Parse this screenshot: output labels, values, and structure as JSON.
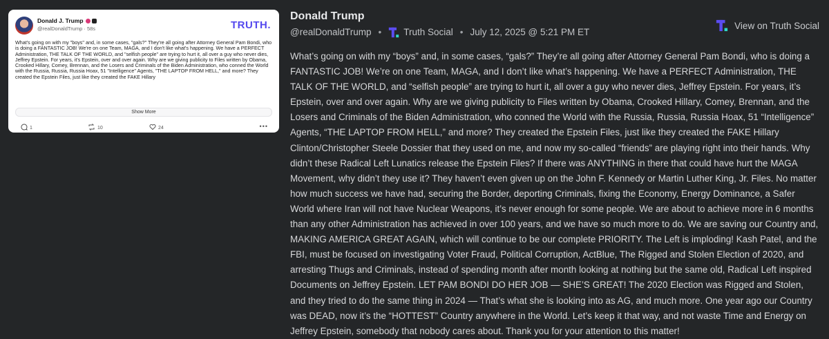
{
  "screenshot": {
    "display_name": "Donald J. Trump",
    "handle_time": "@realDonaldTrump · 58s",
    "logo_text": "TRUTH.",
    "preview_text": "What's going on with my \"boys\" and, in some cases, \"gals?\" They're all going after Attorney General Pam Bondi, who is doing a FANTASTIC JOB! We're on one Team, MAGA, and I don't like what's happening. We have a PERFECT Administration, THE TALK OF THE WORLD, and \"selfish people\" are trying to hurt it, all over a guy who never dies, Jeffrey Epstein. For years, it's Epstein, over and over again. Why are we giving publicity to Files written by Obama, Crooked Hillary, Comey, Brennan, and the Losers and Criminals of the Biden Administration, who conned the World with the Russia, Russia, Russia Hoax, 51 \"Intelligence\" Agents, \"THE LAPTOP FROM HELL,\" and more? They created the Epstein Files, just like they created the FAKE Hillary",
    "show_more": "Show More",
    "replies": "1",
    "retruths": "10",
    "likes": "24"
  },
  "post": {
    "author": "Donald Trump",
    "handle": "@realDonaldTrump",
    "platform": "Truth Social",
    "date": "July 12, 2025 @ 5:21 PM ET",
    "view_link": "View on Truth Social",
    "brand_color": "#5b4cf0",
    "body": "What’s going on with my “boys” and, in some cases, “gals?” They’re all going after Attorney General Pam Bondi, who is doing a FANTASTIC JOB! We’re on one Team, MAGA, and I don’t like what’s happening. We have a PERFECT Administration, THE TALK OF THE WORLD, and “selfish people” are trying to hurt it, all over a guy who never dies, Jeffrey Epstein. For years, it’s Epstein, over and over again. Why are we giving publicity to Files written by Obama, Crooked Hillary, Comey, Brennan, and the Losers and Criminals of the Biden Administration, who conned the World with the Russia, Russia, Russia Hoax, 51 “Intelligence” Agents, “THE LAPTOP FROM HELL,” and more? They created the Epstein Files, just like they created the FAKE Hillary Clinton/Christopher Steele Dossier that they used on me, and now my so-called “friends” are playing right into their hands. Why didn’t these Radical Left Lunatics release the Epstein Files? If there was ANYTHING in there that could have hurt the MAGA Movement, why didn’t they use it? They haven’t even given up on the John F. Kennedy or Martin Luther King, Jr. Files. No matter how much success we have had, securing the Border, deporting Criminals, fixing the Economy, Energy Dominance, a Safer World where Iran will not have Nuclear Weapons, it’s never enough for some people. We are about to achieve more in 6 months than any other Administration has achieved in over 100 years, and we have so much more to do. We are saving our Country and, MAKING AMERICA GREAT AGAIN, which will continue to be our complete PRIORITY. The Left is imploding! Kash Patel, and the FBI, must be focused on investigating Voter Fraud, Political Corruption, ActBlue, The Rigged and Stolen Election of 2020, and arresting Thugs and Criminals, instead of spending month after month looking at nothing but the same old, Radical Left inspired Documents on Jeffrey Epstein. LET PAM BONDI DO HER JOB — SHE’S GREAT! The 2020 Election was Rigged and Stolen, and they tried to do the same thing in 2024 — That’s what she is looking into as AG, and much more. One year ago our Country was DEAD, now it’s the “HOTTEST” Country anywhere in the World. Let’s keep it that way, and not waste Time and Energy on Jeffrey Epstein, somebody that nobody cares about. Thank you for your attention to this matter!"
  }
}
